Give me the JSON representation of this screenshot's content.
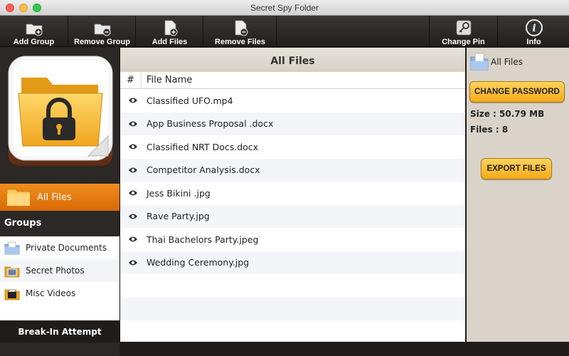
{
  "window": {
    "title": "Secret Spy Folder"
  },
  "toolbar": {
    "add_group": "Add Group",
    "remove_group": "Remove Group",
    "add_files": "Add Files",
    "remove_files": "Remove Files",
    "change_pin": "Change Pin",
    "info": "Info"
  },
  "sidebar": {
    "all_files": "All Files",
    "groups_header": "Groups",
    "groups": [
      {
        "label": "Private Documents",
        "icon": "document-folder-icon"
      },
      {
        "label": "Secret Photos",
        "icon": "photo-folder-icon"
      },
      {
        "label": "Misc Videos",
        "icon": "video-folder-icon"
      }
    ],
    "break_in": "Break-In Attempt"
  },
  "main": {
    "title": "All Files",
    "columns": {
      "num": "#",
      "name": "File Name"
    },
    "files": [
      "Classified UFO.mp4",
      "App Business Proposal .docx",
      "Classified NRT Docs.docx",
      "Competitor Analysis.docx",
      "Jess Bikini .jpg",
      "Rave Party.jpg",
      "Thai Bachelors Party.jpeg",
      "Wedding Ceremony.jpg"
    ]
  },
  "details": {
    "title": "All Files",
    "change_password": "CHANGE PASSWORD",
    "size_label": "Size : 50.79 MB",
    "files_label": "Files : 8",
    "export_files": "EXPORT FILES"
  },
  "colors": {
    "accent": "#e87a12",
    "button": "#f9b52a"
  }
}
